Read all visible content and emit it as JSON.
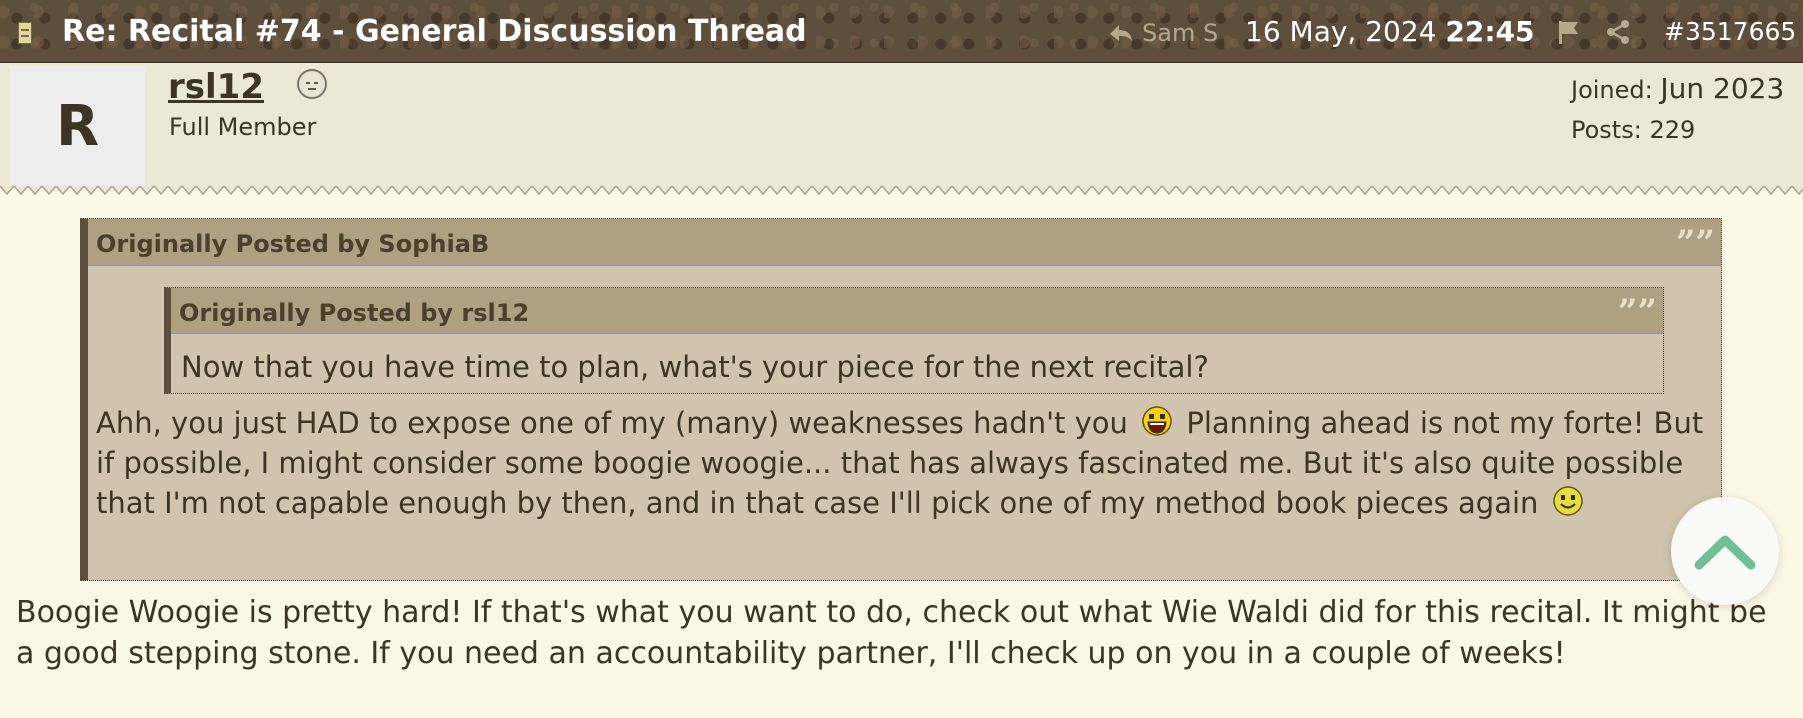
{
  "header": {
    "title": "Re: Recital #74 - General Discussion Thread",
    "reply_to": "Sam S",
    "date": "16 May, 2024",
    "time": "22:45",
    "post_number": "#3517665"
  },
  "user": {
    "avatar_letter": "R",
    "username": "rsl12",
    "title": "Full Member",
    "joined_label": "Joined:",
    "joined_value": "Jun 2023",
    "posts_label": "Posts:",
    "posts_value": "229"
  },
  "quote_outer": {
    "header": "Originally Posted by SophiaB",
    "text_a": "Ahh, you just HAD to expose one of my (many) weaknesses hadn't you",
    "text_b": "Planning ahead is not my forte! But if possible, I might consider some boogie woogie... that has always fascinated me. But it's also quite possible that I'm not capable enough by then, and in that case I'll pick one of my method book pieces again"
  },
  "quote_inner": {
    "header": "Originally Posted by rsl12",
    "text": "Now that you have time to plan, what's your piece for the next recital?"
  },
  "reply_text": "Boogie Woogie is pretty hard! If that's what you want to do, check out what Wie Waldi did for this recital. It might be a good stepping stone. If you need an accountability partner, I'll check up on you in a couple of weeks!",
  "quote_mark_glyph": "””",
  "icons": {
    "thread": "thread-icon",
    "reply_arrow": "reply-arrow-icon",
    "flag": "flag-icon",
    "share": "share-icon",
    "status": "offline-status-icon",
    "smiley_laugh": "laughing-smiley-icon",
    "smiley_smile": "smiley-icon",
    "scroll_top": "chevron-up-icon"
  },
  "colors": {
    "header_bg": "#5e4f3c",
    "page_bg": "#fbf9e6",
    "quote_bg": "#d0c4ae",
    "quote_header_bg": "#aea080",
    "scroll_chevron": "#6fbe95"
  }
}
